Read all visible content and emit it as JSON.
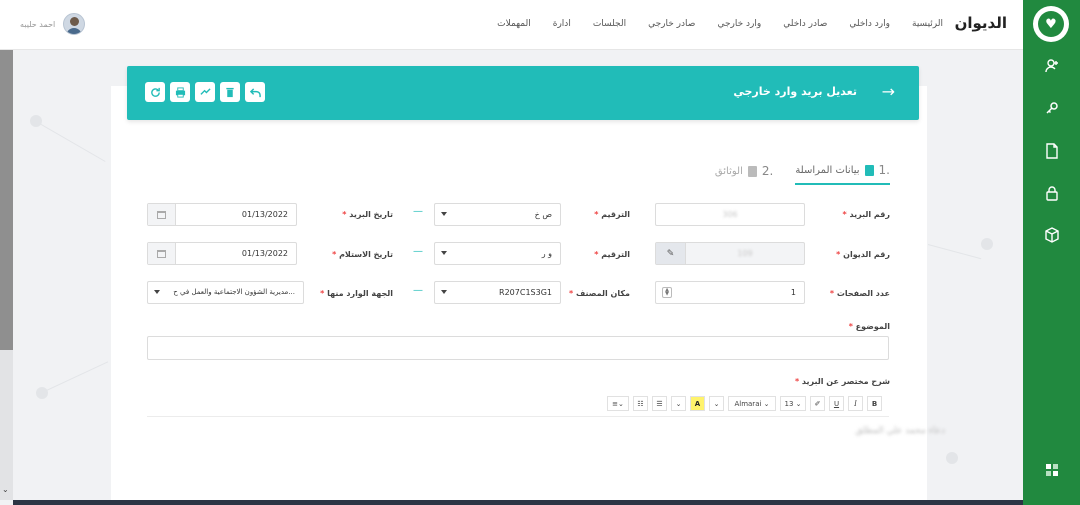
{
  "header": {
    "brand": "الديوان",
    "nav": [
      "الرئيسية",
      "وارد داخلي",
      "صادر داخلي",
      "وارد خارجي",
      "صادر خارجي",
      "الجلسات",
      "ادارة",
      "المهملات"
    ],
    "user_name": "احمد حليبه"
  },
  "page": {
    "title": "تعديل بريد وارد خارجي",
    "actions": [
      "undo-icon",
      "delete-icon",
      "share-icon",
      "print-icon",
      "refresh-icon"
    ]
  },
  "steps": [
    {
      "num": "1.",
      "label": "بيانات المراسلة",
      "active": true
    },
    {
      "num": "2.",
      "label": "الوثائق",
      "active": false
    }
  ],
  "form": {
    "mail_number_label": "رقم البريد",
    "mail_number_value": "306",
    "numbering1_label": "الترقيم",
    "numbering1_value": "ص خ",
    "mail_date_label": "تاريخ البريد",
    "mail_date_value": "01/13/2022",
    "diwan_number_label": "رقم الديوان",
    "diwan_number_value": "109",
    "numbering2_label": "الترقيم",
    "numbering2_value": "و ر",
    "receive_date_label": "تاريخ الاستلام",
    "receive_date_value": "01/13/2022",
    "pages_label": "عدد الصفحات",
    "pages_value": "1",
    "workbook_label": "مكان المصنف",
    "workbook_value": "R207C1S3G1",
    "source_label": "الجهة الوارد منها",
    "source_value": "مديرية الشؤون الاجتماعية والعمل في ح...",
    "subject_label": "الموضوع",
    "subject_value": "",
    "summary_label": "شرح مختصر عن البريد",
    "summary_text": "دعاء محمد علي المطلق"
  },
  "editor": {
    "font_name": "Almarai",
    "font_size": "13"
  }
}
